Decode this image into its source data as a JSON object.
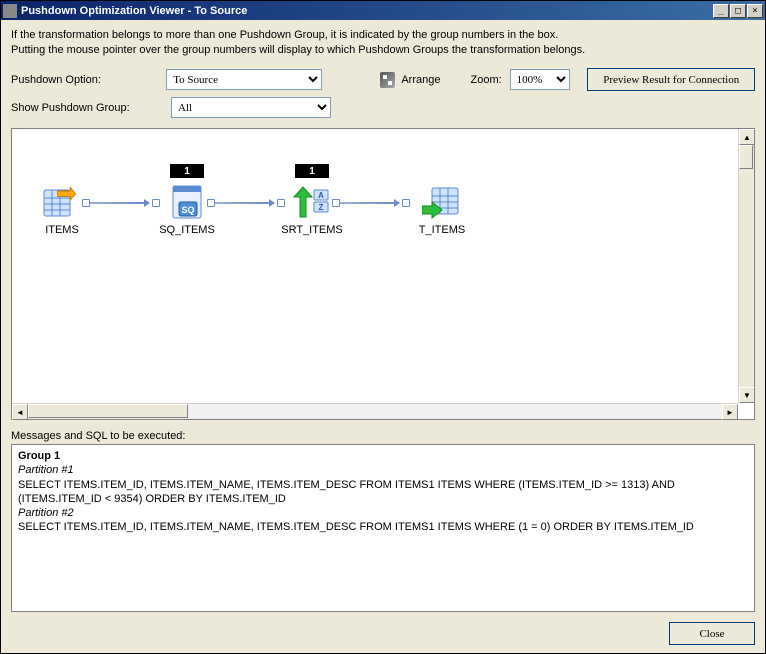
{
  "window": {
    "title": "Pushdown Optimization Viewer -  To Source"
  },
  "info": {
    "line1": "If the transformation belongs to more than one Pushdown Group, it is indicated by the group numbers in the box.",
    "line2": "Putting the mouse pointer over the group numbers will display to which Pushdown Groups the transformation belongs."
  },
  "labels": {
    "pushdown_option": "Pushdown Option:",
    "show_group": "Show Pushdown Group:",
    "arrange": "Arrange",
    "zoom": "Zoom:",
    "preview": "Preview Result for Connection",
    "messages": "Messages and SQL to be executed:",
    "close": "Close"
  },
  "selects": {
    "pushdown_option": "To Source",
    "show_group": "All",
    "zoom": "100%"
  },
  "nodes": {
    "items": {
      "label": "ITEMS"
    },
    "sq_items": {
      "label": "SQ_ITEMS",
      "badge": "1"
    },
    "srt_items": {
      "label": "SRT_ITEMS",
      "badge": "1"
    },
    "t_items": {
      "label": "T_ITEMS"
    }
  },
  "messages": {
    "group_title": "Group 1",
    "p1_label": "Partition #1",
    "p1_sql": "SELECT ITEMS.ITEM_ID, ITEMS.ITEM_NAME, ITEMS.ITEM_DESC FROM ITEMS1 ITEMS WHERE (ITEMS.ITEM_ID >= 1313) AND (ITEMS.ITEM_ID < 9354) ORDER BY ITEMS.ITEM_ID",
    "p2_label": "Partition #2",
    "p2_sql": "SELECT ITEMS.ITEM_ID, ITEMS.ITEM_NAME, ITEMS.ITEM_DESC FROM ITEMS1 ITEMS WHERE (1 = 0) ORDER BY ITEMS.ITEM_ID"
  }
}
